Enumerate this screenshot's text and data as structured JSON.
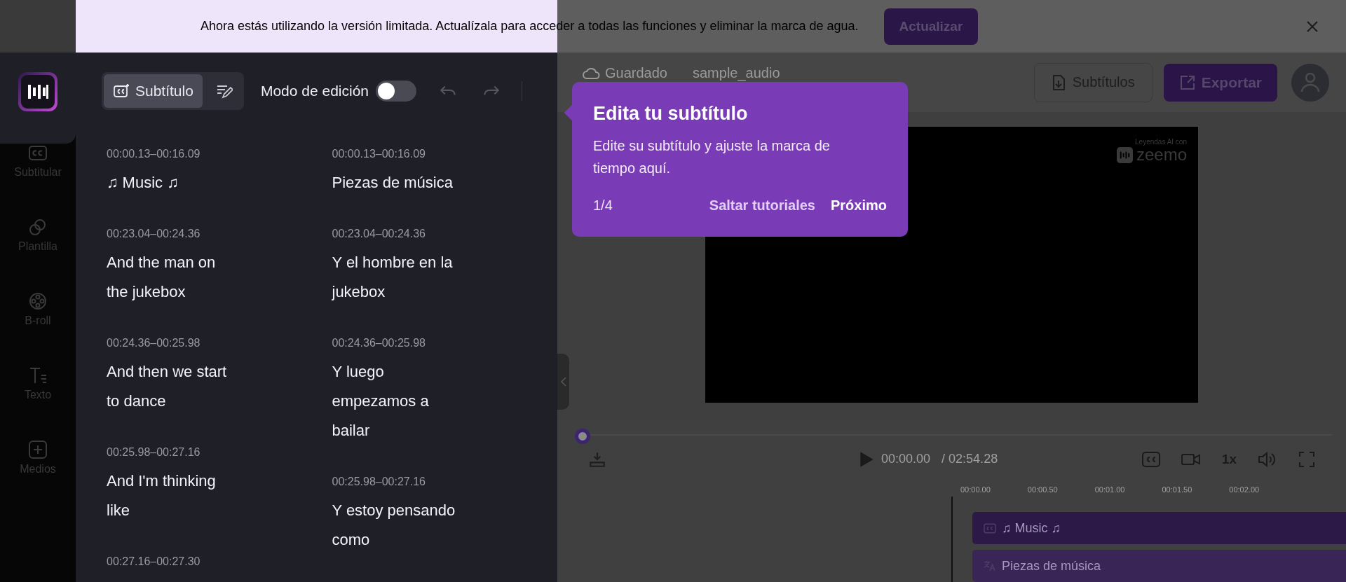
{
  "banner": {
    "message": "Ahora estás utilizando la versión limitada. Actualízala para acceder a todas las funciones y eliminar la marca de agua.",
    "button": "Actualizar"
  },
  "sidebar": {
    "items": [
      {
        "kind": "subtitle",
        "label": "Subtitular"
      },
      {
        "kind": "template",
        "label": "Plantilla"
      },
      {
        "kind": "broll",
        "label": "B-roll"
      },
      {
        "kind": "text",
        "label": "Texto"
      },
      {
        "kind": "media",
        "label": "Medios"
      }
    ]
  },
  "panel": {
    "tabs": [
      {
        "kind": "subtitle",
        "label": "Subtítulo",
        "selected": true
      },
      {
        "kind": "edit",
        "selected": false
      }
    ],
    "edit_mode": {
      "label": "Modo de edición",
      "on": false
    },
    "original": [
      {
        "time": "00:00.13–00:16.09",
        "text": "♫ Music ♫"
      },
      {
        "time": "00:23.04–00:24.36",
        "text": "And the man on the jukebox"
      },
      {
        "time": "00:24.36–00:25.98",
        "text": "And then we start to dance"
      },
      {
        "time": "00:25.98–00:27.16",
        "text": "And I'm thinking like"
      },
      {
        "time": "00:27.16–00:27.30"
      }
    ],
    "translation": [
      {
        "time": "00:00.13–00:16.09",
        "text": "Piezas de música"
      },
      {
        "time": "00:23.04–00:24.36",
        "text": "Y el hombre en la jukebox"
      },
      {
        "time": "00:24.36–00:25.98",
        "text": "Y luego empezamos a bailar"
      },
      {
        "time": "00:25.98–00:27.16",
        "text": "Y estoy pensando como"
      }
    ]
  },
  "header": {
    "saved": "Guardado",
    "project": "sample_audio",
    "subtitles_button": "Subtítulos",
    "export_button": "Exportar"
  },
  "preview": {
    "watermark_caption": "Leyendas AI con",
    "watermark_brand": "zeemo"
  },
  "player": {
    "progress": {
      "level": 0
    },
    "current_time": "00:00.00",
    "duration": "/ 02:54.28",
    "speed": "1x"
  },
  "timeline": {
    "ticks": [
      "00:00.00",
      "00:00.50",
      "00:01.00",
      "00:01.50",
      "00:02.00"
    ],
    "tracks": [
      {
        "kind": "subtitle",
        "label": "♫ Music ♫"
      },
      {
        "kind": "translation",
        "label": "Piezas de música"
      }
    ]
  },
  "tooltip": {
    "title": "Edita tu subtítulo",
    "body": "Edite su subtítulo y ajuste la marca de tiempo aquí.",
    "step": "1/4",
    "skip": "Saltar tutoriales",
    "next": "Próximo"
  }
}
